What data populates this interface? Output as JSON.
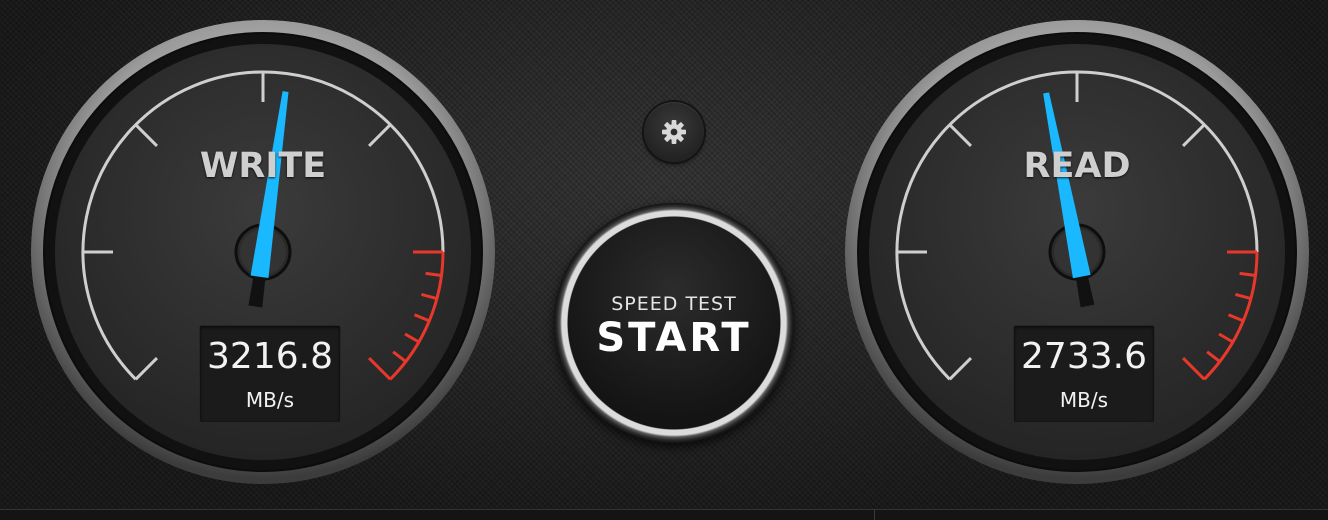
{
  "write_gauge": {
    "label": "WRITE",
    "value": "3216.8",
    "unit": "MB/s",
    "needle_angle_deg": 8
  },
  "read_gauge": {
    "label": "READ",
    "value": "2733.6",
    "unit": "MB/s",
    "needle_angle_deg": -11
  },
  "start_button": {
    "subtitle": "SPEED TEST",
    "label": "START"
  },
  "settings_button": {
    "icon": "gear-icon"
  },
  "colors": {
    "needle": "#1ab8ff",
    "redzone": "#e8382c",
    "ticks": "#cfcfcf"
  }
}
